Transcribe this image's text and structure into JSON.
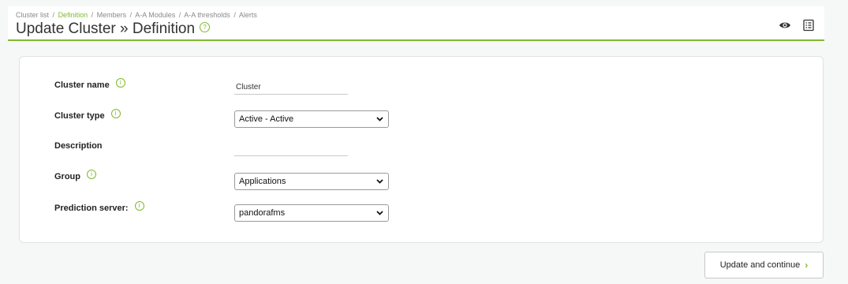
{
  "breadcrumb": {
    "items": [
      "Cluster list",
      "Definition",
      "Members",
      "A-A Modules",
      "A-A thresholds",
      "Alerts"
    ],
    "separator": "/"
  },
  "page": {
    "title": "Update Cluster » Definition",
    "help_icon": "?"
  },
  "header_actions": {
    "view_icon": "eye-icon",
    "list_icon": "list-icon"
  },
  "form": {
    "cluster_name": {
      "label": "Cluster name",
      "value": "Cluster",
      "info": "i"
    },
    "cluster_type": {
      "label": "Cluster type",
      "selected": "Active - Active",
      "info": "i"
    },
    "description": {
      "label": "Description",
      "value": ""
    },
    "group": {
      "label": "Group",
      "selected": "Applications",
      "info": "i"
    },
    "prediction_server": {
      "label": "Prediction server:",
      "selected": "pandorafms",
      "info": "i"
    }
  },
  "actions": {
    "update_label": "Update and continue",
    "update_arrow": "›"
  },
  "colors": {
    "accent": "#82b92e",
    "background": "#f6f7f7"
  }
}
